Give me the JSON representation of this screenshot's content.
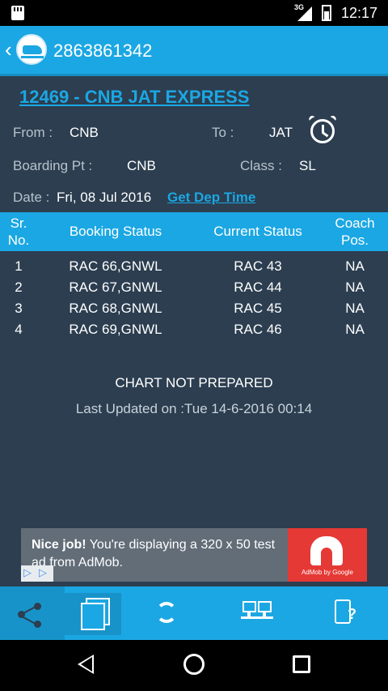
{
  "status_bar": {
    "network": "3G",
    "time": "12:17"
  },
  "app_bar": {
    "pnr": "2863861342"
  },
  "train": {
    "title": "12469 - CNB JAT EXPRESS"
  },
  "journey": {
    "from_label": "From :",
    "from_value": "CNB",
    "to_label": "To :",
    "to_value": "JAT",
    "boarding_label": "Boarding Pt :",
    "boarding_value": "CNB",
    "class_label": "Class :",
    "class_value": "SL",
    "date_label": "Date :",
    "date_value": "Fri, 08 Jul 2016",
    "dep_time_link": "Get Dep Time"
  },
  "table": {
    "headers": {
      "sr_line1": "Sr.",
      "sr_line2": "No.",
      "booking": "Booking Status",
      "current": "Current Status",
      "coach_line1": "Coach",
      "coach_line2": "Pos."
    },
    "rows": [
      {
        "sr": "1",
        "booking": "RAC 66,GNWL",
        "current": "RAC 43",
        "coach": "NA"
      },
      {
        "sr": "2",
        "booking": "RAC 67,GNWL",
        "current": "RAC 44",
        "coach": "NA"
      },
      {
        "sr": "3",
        "booking": "RAC 68,GNWL",
        "current": "RAC 45",
        "coach": "NA"
      },
      {
        "sr": "4",
        "booking": "RAC 69,GNWL",
        "current": "RAC 46",
        "coach": "NA"
      }
    ]
  },
  "chart_status": "CHART NOT PREPARED",
  "last_updated": "Last Updated on :Tue 14-6-2016 00:14",
  "ad": {
    "headline": "Nice job!",
    "body": " You're displaying a 320 x 50 test ad from AdMob.",
    "brand": "AdMob by Google"
  },
  "colors": {
    "accent": "#1ba7e3",
    "background": "#2c3e50",
    "ad_red": "#e53935"
  }
}
